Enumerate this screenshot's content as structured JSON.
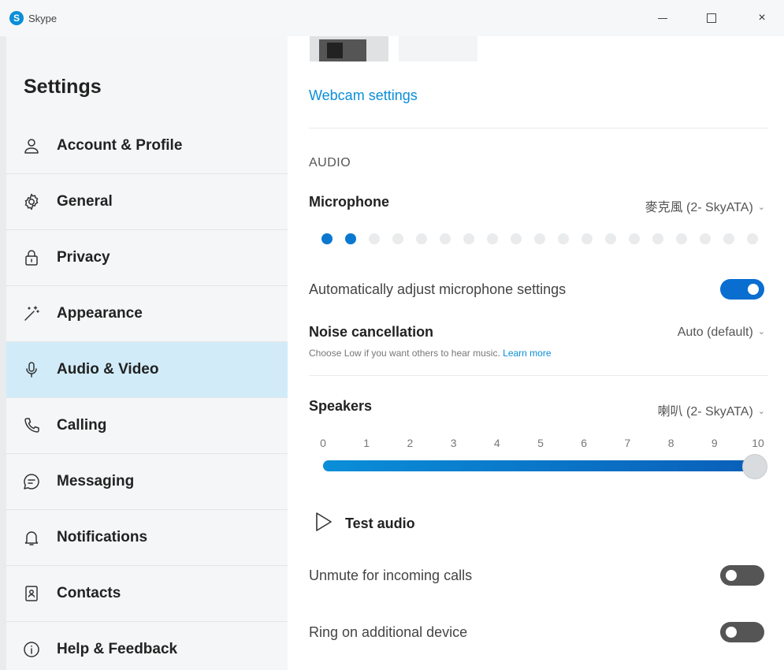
{
  "window": {
    "title": "Skype",
    "logo_letter": "S",
    "minimize_icon": "minimize-icon",
    "maximize_icon": "maximize-icon",
    "close_icon": "close-icon",
    "close_glyph": "×"
  },
  "sidebar": {
    "title": "Settings",
    "items": [
      {
        "label": "Account & Profile",
        "icon": "person-icon",
        "active": false
      },
      {
        "label": "General",
        "icon": "gear-icon",
        "active": false
      },
      {
        "label": "Privacy",
        "icon": "lock-icon",
        "active": false
      },
      {
        "label": "Appearance",
        "icon": "magic-wand-icon",
        "active": false
      },
      {
        "label": "Audio & Video",
        "icon": "microphone-icon",
        "active": true
      },
      {
        "label": "Calling",
        "icon": "phone-icon",
        "active": false
      },
      {
        "label": "Messaging",
        "icon": "chat-bubble-icon",
        "active": false
      },
      {
        "label": "Notifications",
        "icon": "bell-icon",
        "active": false
      },
      {
        "label": "Contacts",
        "icon": "contact-card-icon",
        "active": false
      },
      {
        "label": "Help & Feedback",
        "icon": "info-icon",
        "active": false
      }
    ]
  },
  "video": {
    "webcam_settings_link": "Webcam settings"
  },
  "audio": {
    "section_label": "AUDIO",
    "microphone": {
      "label": "Microphone",
      "device": "麥克風 (2- SkyATA)",
      "level_dots_total": 19,
      "level_dots_active": 2
    },
    "auto_adjust": {
      "label": "Automatically adjust microphone settings",
      "enabled": true
    },
    "noise_cancellation": {
      "label": "Noise cancellation",
      "value": "Auto (default)",
      "hint": "Choose Low if you want others to hear music.",
      "hint_link": "Learn more"
    },
    "speakers": {
      "label": "Speakers",
      "device": "喇叭 (2- SkyATA)",
      "ticks": [
        "0",
        "1",
        "2",
        "3",
        "4",
        "5",
        "6",
        "7",
        "8",
        "9",
        "10"
      ],
      "volume": 10,
      "max": 10
    },
    "test_audio": {
      "label": "Test audio",
      "icon": "play-icon"
    },
    "unmute_incoming": {
      "label": "Unmute for incoming calls",
      "enabled": false
    },
    "ring_additional": {
      "label": "Ring on additional device",
      "enabled": false
    }
  },
  "colors": {
    "accent": "#0a8ed8",
    "active_nav": "#d1ecf8",
    "toggle_on": "#0a6ed1",
    "toggle_off": "#555555"
  }
}
